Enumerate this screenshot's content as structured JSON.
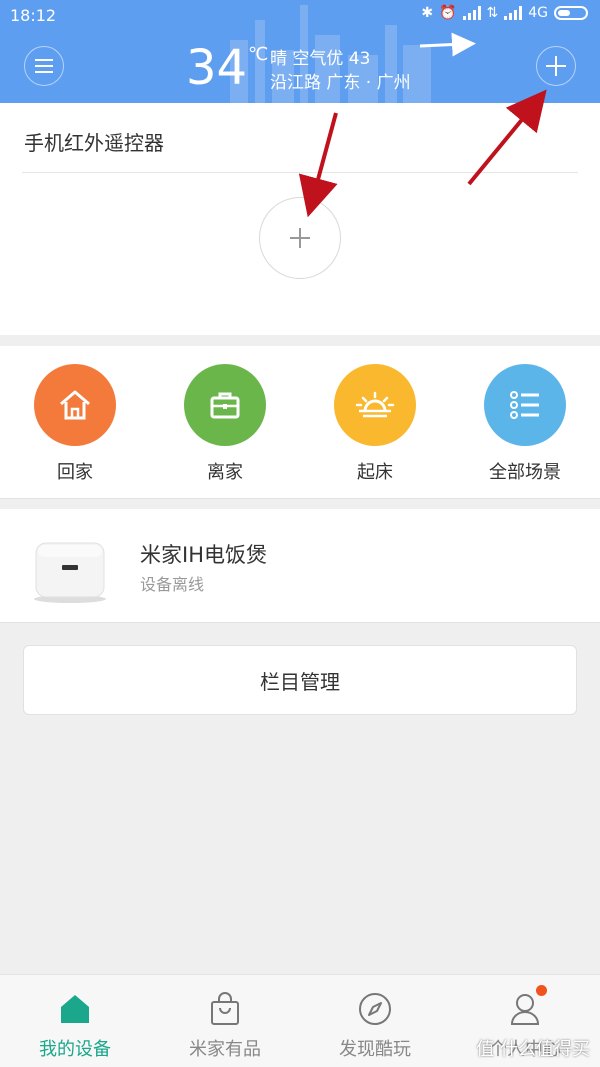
{
  "status_bar": {
    "time": "18:12",
    "network": "4G"
  },
  "header": {
    "menu_icon": "menu-icon",
    "temperature": "34",
    "unit": "℃",
    "weather": "晴 空气优 43",
    "location": "沿江路 广东 · 广州",
    "add_icon": "plus-icon"
  },
  "remote_card": {
    "title": "手机红外遥控器",
    "add_icon": "plus-icon"
  },
  "scenes": [
    {
      "label": "回家",
      "icon": "home-icon",
      "color": "#f37a3b"
    },
    {
      "label": "离家",
      "icon": "briefcase-icon",
      "color": "#6ab64b"
    },
    {
      "label": "起床",
      "icon": "sunrise-icon",
      "color": "#f9b82e"
    },
    {
      "label": "全部场景",
      "icon": "list-icon",
      "color": "#5bb5e9"
    }
  ],
  "device": {
    "name": "米家IH电饭煲",
    "status": "设备离线",
    "icon": "rice-cooker-icon"
  },
  "manage_button": {
    "label": "栏目管理"
  },
  "tabs": [
    {
      "label": "我的设备",
      "icon": "home-tab-icon",
      "active": true
    },
    {
      "label": "米家有品",
      "icon": "shopping-bag-icon",
      "active": false
    },
    {
      "label": "发现酷玩",
      "icon": "compass-icon",
      "active": false
    },
    {
      "label": "个人中心",
      "icon": "user-icon",
      "active": false
    }
  ],
  "watermark": "值 什么值得买",
  "colors": {
    "header_bg": "#5e9ef0",
    "accent": "#1aa78c",
    "annotation_arrow": "#c0121c",
    "notification_dot": "#f2521d"
  }
}
